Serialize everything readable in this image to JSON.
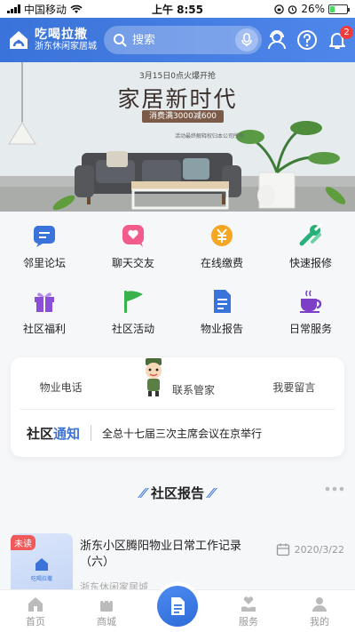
{
  "status_bar": {
    "carrier": "中国移动",
    "time": "上午 8:55",
    "battery": "26%",
    "battery_level": 0.26
  },
  "header": {
    "logo_title": "吃喝拉撒",
    "logo_subtitle": "浙东休闲家居城",
    "search_placeholder": "搜索",
    "notification_count": "2"
  },
  "banner": {
    "pre_title": "3月15日0点火爆开抢",
    "title": "家居新时代",
    "promo": "消费满3000减600",
    "note": "活动最终解释权归本公司所有"
  },
  "menu": [
    {
      "label": "邻里论坛",
      "icon": "forum-icon",
      "color": "#3a73d9"
    },
    {
      "label": "聊天交友",
      "icon": "chat-heart-icon",
      "color": "#f25c8a"
    },
    {
      "label": "在线缴费",
      "icon": "payment-icon",
      "color": "#f5a623"
    },
    {
      "label": "快速报修",
      "icon": "repair-icon",
      "color": "#27b07a"
    },
    {
      "label": "社区福利",
      "icon": "gift-icon",
      "color": "#8a4fd6"
    },
    {
      "label": "社区活动",
      "icon": "flag-icon",
      "color": "#37b24d"
    },
    {
      "label": "物业报告",
      "icon": "document-icon",
      "color": "#3a73d9"
    },
    {
      "label": "日常服务",
      "icon": "coffee-icon",
      "color": "#7d3fc8"
    }
  ],
  "contact": {
    "phone": "物业电话",
    "butler": "联系管家",
    "message": "我要留言"
  },
  "notice": {
    "tag_a": "社区",
    "tag_b": "通知",
    "text": "全总十七届三次主席会议在京举行"
  },
  "section": {
    "title": "社区报告"
  },
  "report": {
    "tag": "未读",
    "thumb_text": "吃喝拉撒",
    "title": "浙东小区腾阳物业日常工作记录（六）",
    "date": "2020/3/22",
    "source": "浙东休闲家居城"
  },
  "tabbar": [
    {
      "label": "首页",
      "icon": "home-icon"
    },
    {
      "label": "商城",
      "icon": "shopping-bag-icon"
    },
    {
      "label": "",
      "icon": "document-fab-icon"
    },
    {
      "label": "服务",
      "icon": "service-icon"
    },
    {
      "label": "我的",
      "icon": "profile-icon"
    }
  ],
  "colors": {
    "primary": "#3a73d9",
    "badge": "#f23b3b",
    "unread": "#f05a5a"
  }
}
